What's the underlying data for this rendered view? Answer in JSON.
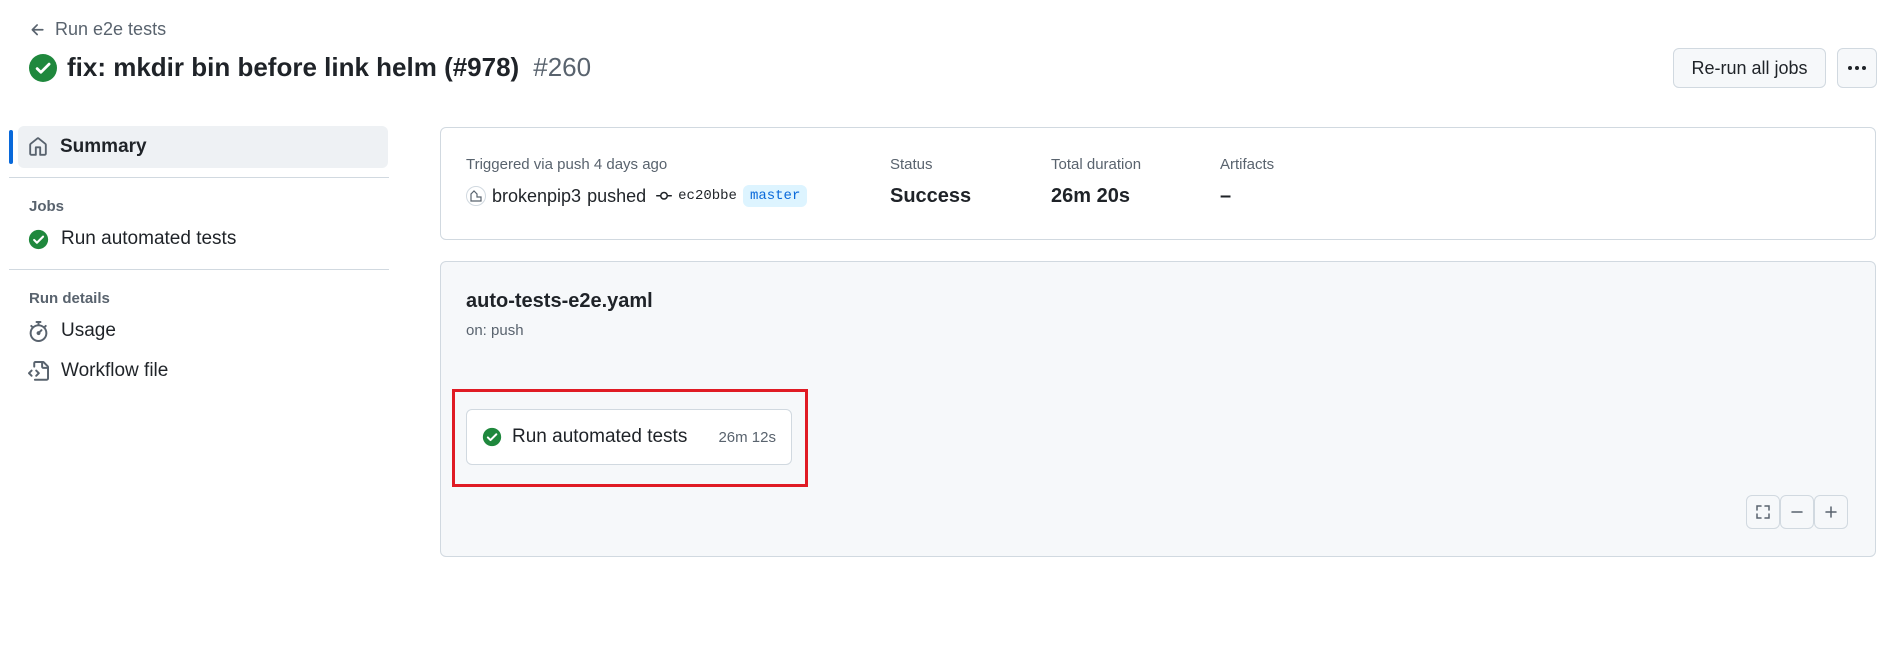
{
  "header": {
    "back_label": "Run e2e tests",
    "run_title": "fix: mkdir bin before link helm (#978)",
    "run_number": "#260",
    "rerun_label": "Re-run all jobs"
  },
  "sidebar": {
    "summary_label": "Summary",
    "jobs_heading": "Jobs",
    "jobs": [
      {
        "label": "Run automated tests",
        "status": "success"
      }
    ],
    "run_details_heading": "Run details",
    "details": [
      {
        "label": "Usage",
        "icon": "stopwatch-icon"
      },
      {
        "label": "Workflow file",
        "icon": "file-code-icon"
      }
    ]
  },
  "summary": {
    "trigger_label": "Triggered via push 4 days ago",
    "actor": "brokenpip3",
    "action": "pushed",
    "commit": "ec20bbe",
    "branch": "master",
    "status_label": "Status",
    "status_value": "Success",
    "duration_label": "Total duration",
    "duration_value": "26m 20s",
    "artifacts_label": "Artifacts",
    "artifacts_value": "–"
  },
  "workflow": {
    "file_name": "auto-tests-e2e.yaml",
    "trigger": "on: push",
    "job": {
      "name": "Run automated tests",
      "duration": "26m 12s"
    }
  },
  "colors": {
    "success": "#1f883d",
    "accent": "#0969da",
    "highlight": "#e01b24"
  }
}
